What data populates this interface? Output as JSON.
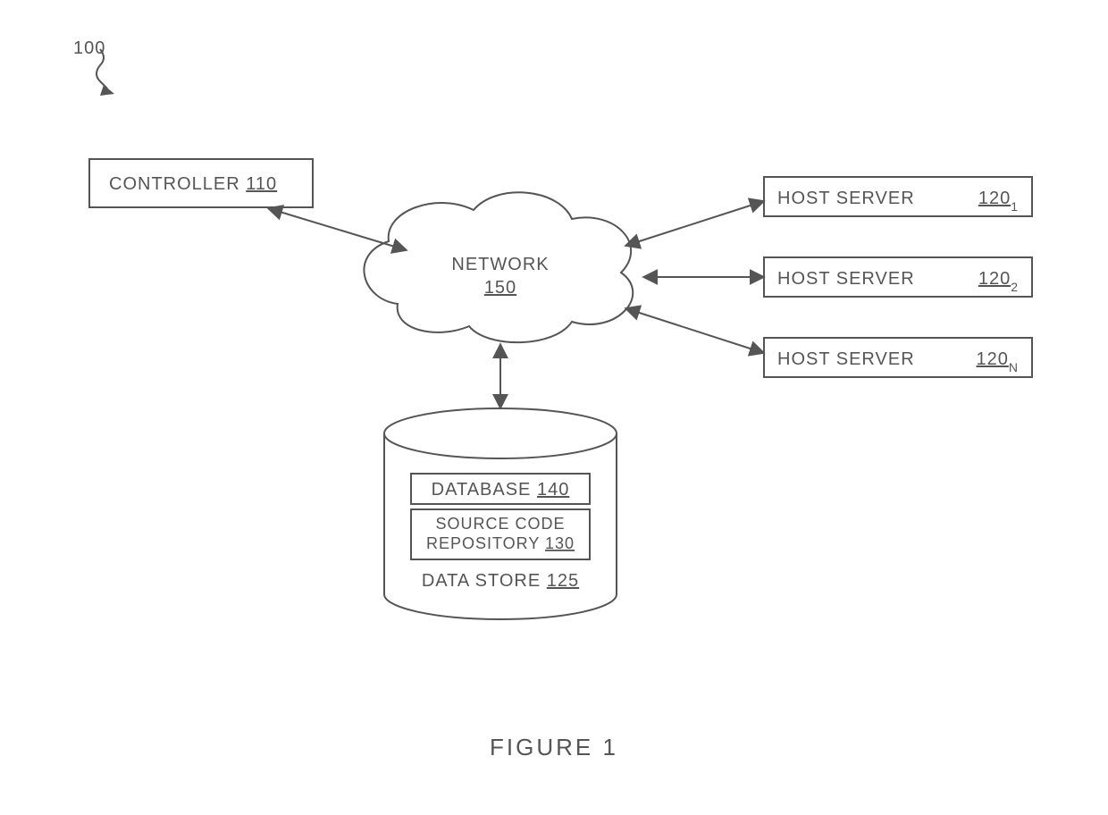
{
  "figure_ref": "100",
  "controller": {
    "label": "CONTROLLER",
    "ref": "110"
  },
  "network": {
    "label": "NETWORK",
    "ref": "150"
  },
  "hosts": [
    {
      "label": "HOST SERVER",
      "ref": "120",
      "sub": "1"
    },
    {
      "label": "HOST SERVER",
      "ref": "120",
      "sub": "2"
    },
    {
      "label": "HOST SERVER",
      "ref": "120",
      "sub": "N"
    }
  ],
  "datastore": {
    "label": "DATA STORE",
    "ref": "125",
    "database": {
      "label": "DATABASE",
      "ref": "140"
    },
    "repo": {
      "label": "SOURCE CODE REPOSITORY",
      "ref": "130"
    }
  },
  "caption": "FIGURE 1"
}
